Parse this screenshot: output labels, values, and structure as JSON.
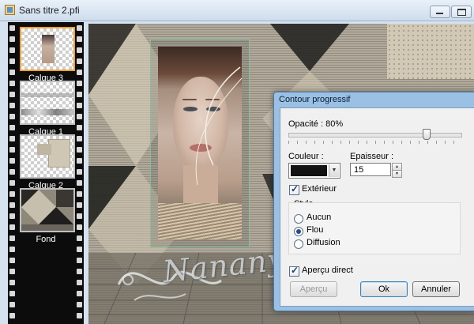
{
  "window": {
    "title": "Sans titre 2.pfi"
  },
  "layers": [
    {
      "label": "Calque 3",
      "selected": true
    },
    {
      "label": "Calque 1",
      "selected": false
    },
    {
      "label": "Calque 2",
      "selected": false
    },
    {
      "label": "Fond",
      "selected": false
    }
  ],
  "canvas": {
    "watermark_text": "Nanany"
  },
  "dialog": {
    "title": "Contour progressif",
    "opacity_label": "Opacité : 80%",
    "opacity_value": 80,
    "color_label": "Couleur :",
    "color_value": "#121212",
    "thickness_label": "Epaisseur :",
    "thickness_value": "15",
    "exterior_label": "Extérieur",
    "exterior_checked": true,
    "style_label": "Style",
    "style_options": [
      {
        "label": "Aucun",
        "selected": false
      },
      {
        "label": "Flou",
        "selected": true
      },
      {
        "label": "Diffusion",
        "selected": false
      }
    ],
    "live_preview_label": "Aperçu direct",
    "live_preview_checked": true,
    "preview_button": "Aperçu",
    "ok_button": "Ok",
    "cancel_button": "Annuler"
  }
}
